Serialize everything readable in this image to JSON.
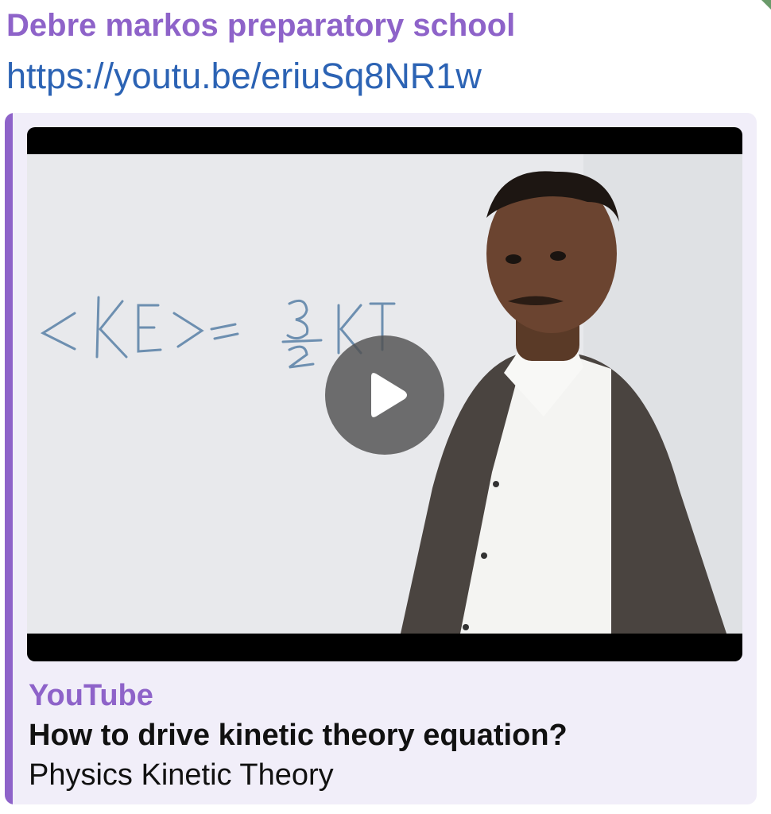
{
  "message": {
    "sender": "Debre markos preparatory school",
    "link": "https://youtu.be/eriuSq8NR1w"
  },
  "preview": {
    "site_name": "YouTube",
    "title": "How to drive kinetic theory equation?",
    "description": "Physics Kinetic Theory",
    "thumbnail": {
      "whiteboard_text": "<KE> = 3/2 KT"
    }
  },
  "colors": {
    "accent": "#8e63c9",
    "link": "#2c63b4",
    "preview_background": "#f1eef9"
  },
  "icons": {
    "play": "play-icon"
  }
}
